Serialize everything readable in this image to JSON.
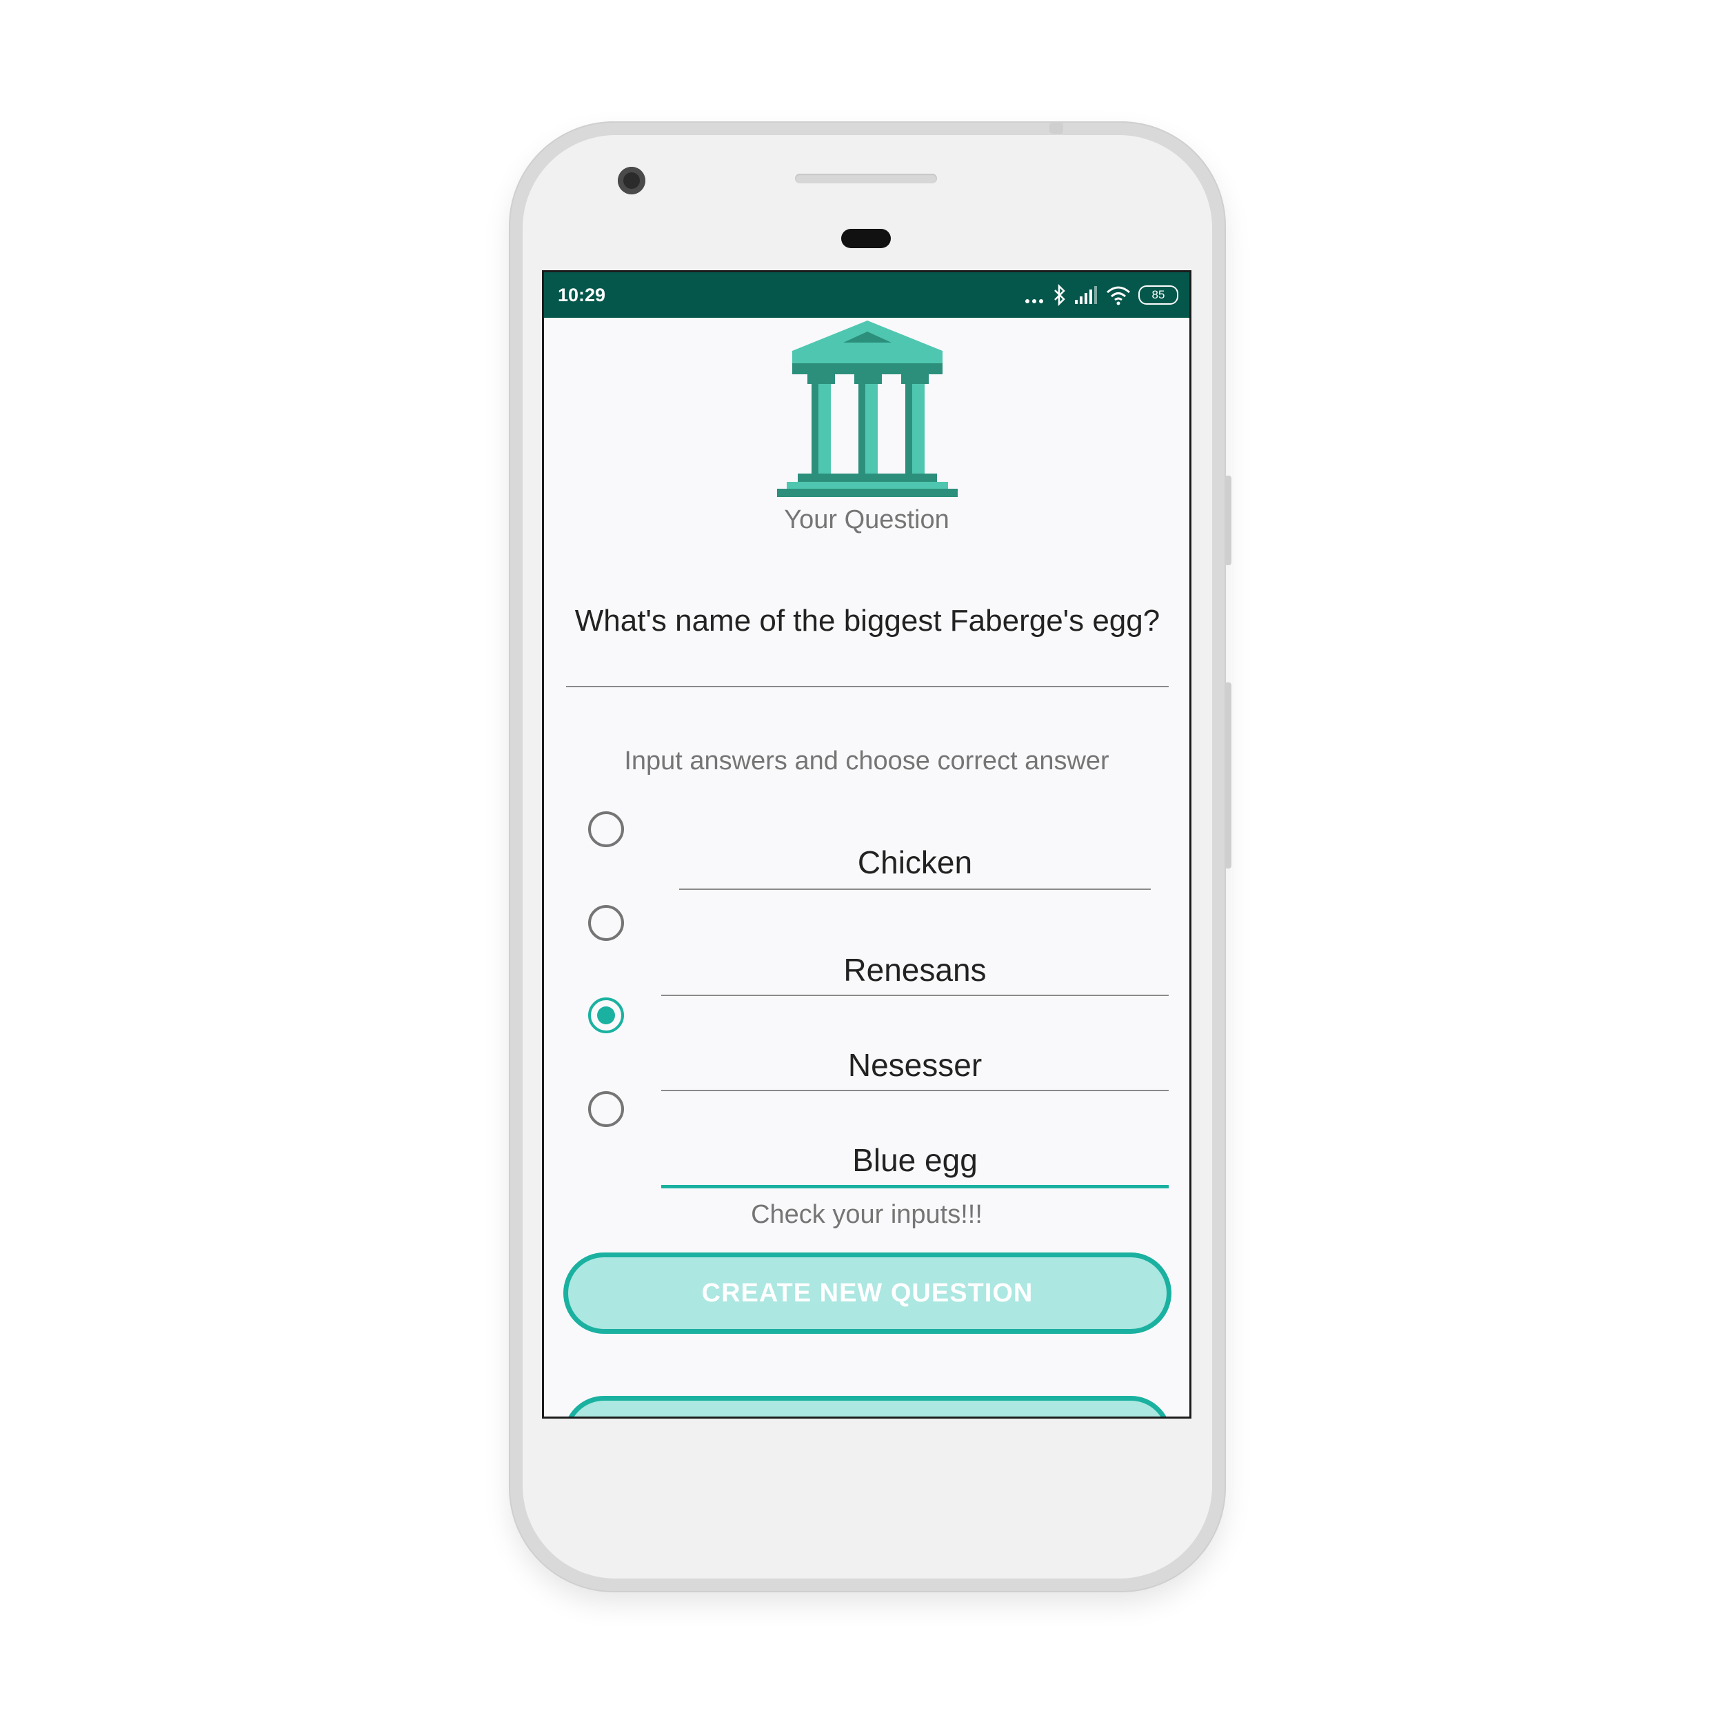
{
  "status_bar": {
    "time": "10:29",
    "battery": "85"
  },
  "header": {
    "title": "Your Question"
  },
  "question": {
    "text": "What's name of the biggest Faberge's egg?"
  },
  "answers_section": {
    "instruction": "Input answers and choose correct answer",
    "answers": [
      {
        "text": "Chicken",
        "selected": false
      },
      {
        "text": "Renesans",
        "selected": false
      },
      {
        "text": "Nesesser",
        "selected": true
      },
      {
        "text": "Blue egg",
        "selected": false
      }
    ]
  },
  "validation": {
    "message": "Check your inputs!!!"
  },
  "actions": {
    "create_label": "CREATE NEW QUESTION"
  },
  "colors": {
    "accent": "#1ab1a0",
    "status_bar": "#05574b",
    "button_fill": "#ace7e1"
  }
}
